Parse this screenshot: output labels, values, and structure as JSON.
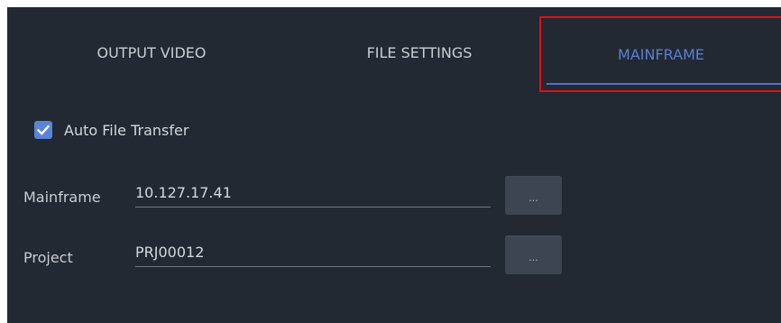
{
  "tabs": [
    {
      "label": "OUTPUT VIDEO"
    },
    {
      "label": "FILE SETTINGS"
    },
    {
      "label": "MAINFRAME"
    }
  ],
  "active_tab": "MAINFRAME",
  "auto_file_transfer": {
    "label": "Auto File Transfer",
    "checked": true
  },
  "mainframe": {
    "label": "Mainframe",
    "value": "10.127.17.41",
    "browse_label": "..."
  },
  "project": {
    "label": "Project",
    "value": "PRJ00012",
    "browse_label": "..."
  },
  "colors": {
    "background": "#222933",
    "accent": "#5b7fd1",
    "highlight_border": "#e01010"
  }
}
